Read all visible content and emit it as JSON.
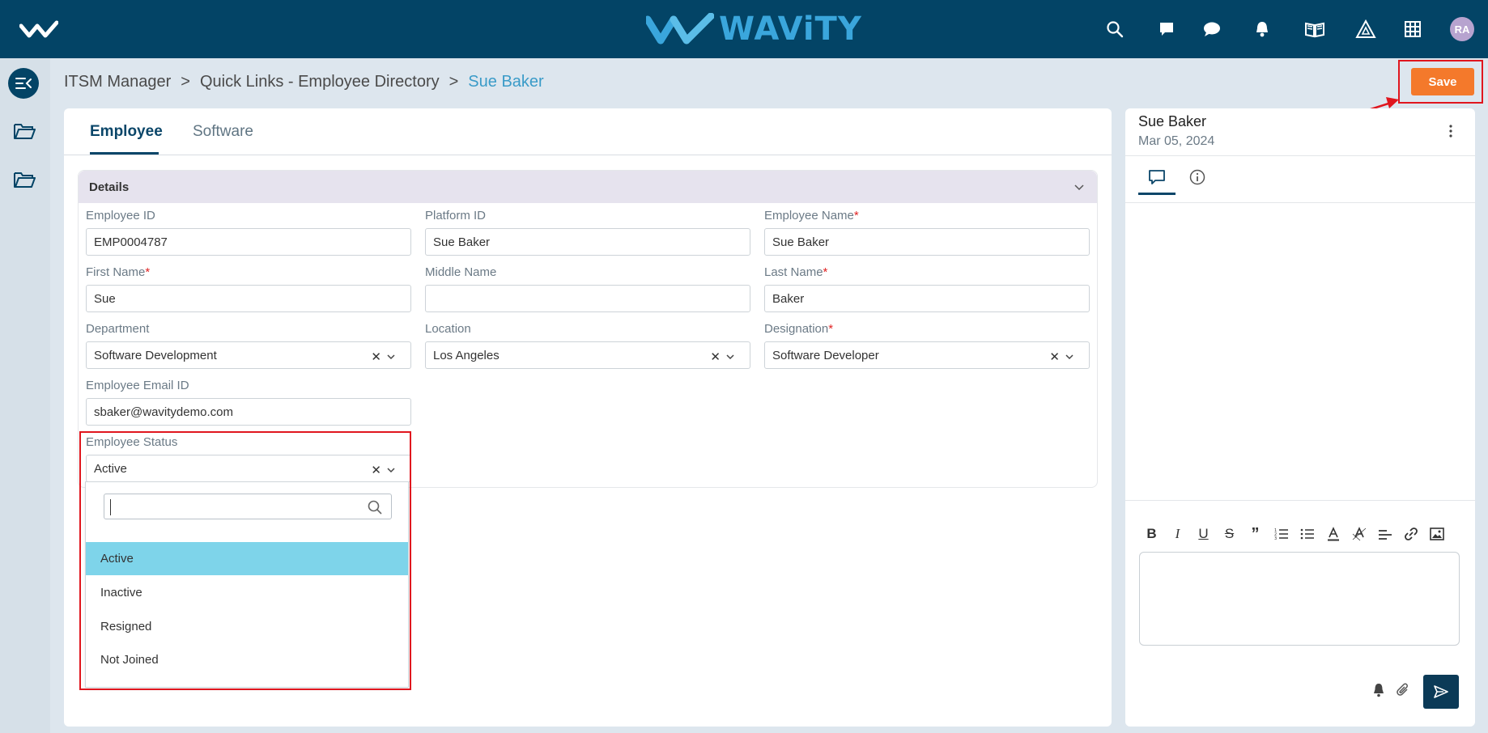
{
  "brand": {
    "name": "WAViTY"
  },
  "user": {
    "initials": "RA"
  },
  "breadcrumb": {
    "items": [
      "ITSM Manager",
      "Quick Links - Employee Directory"
    ],
    "separator": ">",
    "current": "Sue Baker"
  },
  "toolbar": {
    "save_label": "Save"
  },
  "tabs": [
    "Employee",
    "Software"
  ],
  "section": {
    "title": "Details"
  },
  "fields": {
    "employee_id": {
      "label": "Employee ID",
      "value": "EMP0004787"
    },
    "platform_id": {
      "label": "Platform ID",
      "value": "Sue Baker"
    },
    "employee_name": {
      "label": "Employee Name",
      "value": "Sue Baker",
      "required": "*"
    },
    "first_name": {
      "label": "First Name",
      "value": "Sue",
      "required": "*"
    },
    "middle_name": {
      "label": "Middle Name",
      "value": ""
    },
    "last_name": {
      "label": "Last Name",
      "value": "Baker",
      "required": "*"
    },
    "department": {
      "label": "Department",
      "value": "Software Development"
    },
    "location": {
      "label": "Location",
      "value": "Los Angeles"
    },
    "designation": {
      "label": "Designation",
      "value": "Software Developer",
      "required": "*"
    },
    "email": {
      "label": "Employee Email ID",
      "value": "sbaker@wavitydemo.com"
    },
    "status": {
      "label": "Employee Status",
      "value": "Active"
    }
  },
  "status_dropdown": {
    "search_value": "",
    "options": [
      "Active",
      "Inactive",
      "Resigned",
      "Not Joined"
    ],
    "selected": "Active"
  },
  "side_panel": {
    "name": "Sue Baker",
    "date": "Mar 05, 2024"
  },
  "icons": [
    "search-icon",
    "chat-square-icon",
    "chat-bubble-icon",
    "bell-icon",
    "book-icon",
    "triangle-icon",
    "grid-icon",
    "menu-collapse-icon",
    "folder-icon",
    "kebab-icon",
    "comment-icon",
    "info-icon",
    "bold-icon",
    "italic-icon",
    "underline-icon",
    "strikethrough-icon",
    "quote-icon",
    "ordered-list-icon",
    "bullet-list-icon",
    "text-color-icon",
    "highlight-icon",
    "align-icon",
    "link-icon",
    "image-icon",
    "attach-icon",
    "send-icon"
  ],
  "colors": {
    "header": "#034466",
    "accent": "#3aa6dc",
    "save": "#f4792b",
    "selected_option": "#7ed4ea",
    "highlight": "#e0161e"
  }
}
